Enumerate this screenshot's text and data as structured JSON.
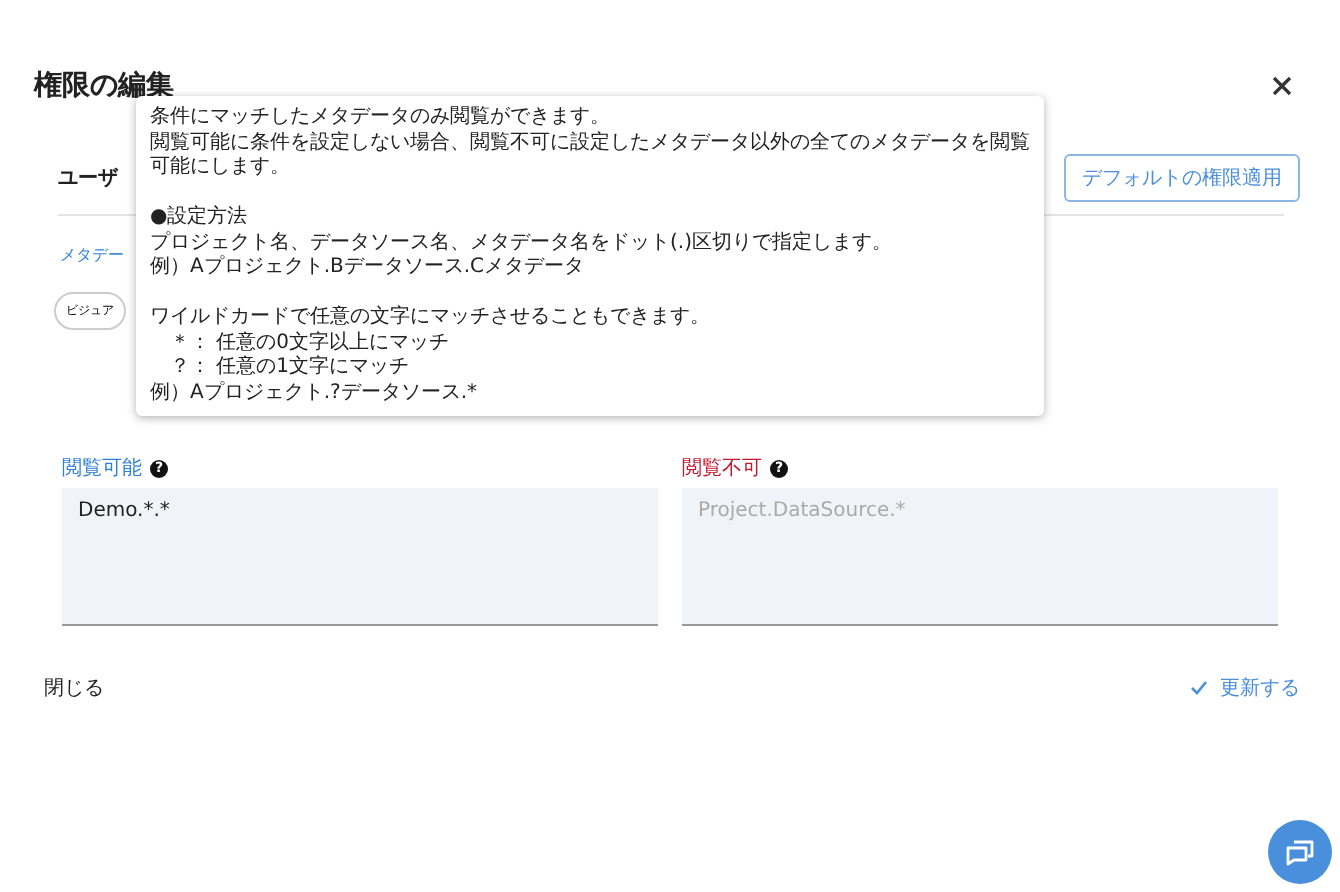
{
  "dialog": {
    "title": "権限の編集",
    "section_title": "ユーザ",
    "default_button": "デフォルトの権限適用",
    "link": "メタデー",
    "chip": "ビジュア"
  },
  "tooltip": {
    "paragraphs": [
      [
        {
          "text": "条件にマッチしたメタデータのみ閲覧ができます。",
          "indented": false
        },
        {
          "text": "閲覧可能に条件を設定しない場合、閲覧不可に設定したメタデータ以外の全てのメタデータを閲覧可能にします。",
          "indented": false
        }
      ],
      [
        {
          "text": "●設定方法",
          "indented": false
        },
        {
          "text": "プロジェクト名、データソース名、メタデータ名をドット(.)区切りで指定します。",
          "indented": false
        },
        {
          "text": "例）Aプロジェクト.Bデータソース.Cメタデータ",
          "indented": false
        }
      ],
      [
        {
          "text": "ワイルドカードで任意の文字にマッチさせることもできます。",
          "indented": false
        },
        {
          "text": "＊： 任意の0文字以上にマッチ",
          "indented": true
        },
        {
          "text": "？： 任意の1文字にマッチ",
          "indented": true
        },
        {
          "text": "例）Aプロジェクト.?データソース.*",
          "indented": false
        }
      ]
    ]
  },
  "fields": [
    {
      "kind": "allow",
      "label": "閲覧可能",
      "help": "?",
      "value": "Demo.*.*"
    },
    {
      "kind": "deny",
      "label": "閲覧不可",
      "help": "?",
      "placeholder": "Project.DataSource.*"
    }
  ],
  "footer": {
    "close": "閉じる",
    "update": "更新する"
  }
}
